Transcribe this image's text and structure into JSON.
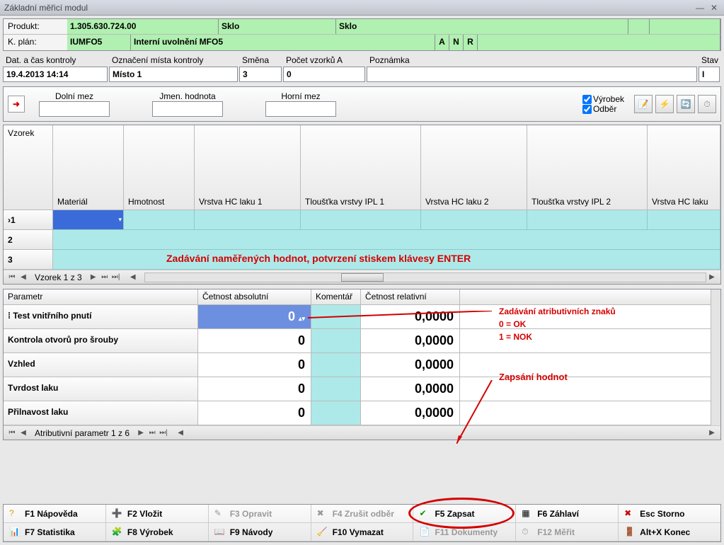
{
  "title": "Základní měřicí modul",
  "prod": {
    "lbl_produkt": "Produkt:",
    "lbl_kplan": "K. plán:",
    "produkt_kod": "1.305.630.724.00",
    "produkt_typ1": "Sklo",
    "produkt_typ2": "Sklo",
    "kplan_kod": "IUMFO5",
    "kplan_nazev": "Interní uvolnění MFO5",
    "a": "A",
    "n": "N",
    "r": "R"
  },
  "hdr": {
    "lbl_dat": "Dat. a čas kontroly",
    "lbl_misto": "Označení místa kontroly",
    "lbl_smena": "Směna",
    "lbl_pocet": "Počet vzorků A",
    "lbl_pozn": "Poznámka",
    "lbl_stav": "Stav",
    "dat": "19.4.2013 14:14",
    "misto": "Místo 1",
    "smena": "3",
    "pocet": "0",
    "pozn": "",
    "stav": "I"
  },
  "limits": {
    "dolni": "Dolní mez",
    "jmen": "Jmen. hodnota",
    "horni": "Horní mez",
    "chk_vyrobek": "Výrobek",
    "chk_odber": "Odběr"
  },
  "grid1": {
    "corner": "Vzorek",
    "cols": [
      "Materiál",
      "Hmotnost",
      "Vrstva HC laku 1",
      "Tloušťka vrstvy IPL 1",
      "Vrstva HC laku 2",
      "Tloušťka vrstvy IPL 2",
      "Vrstva HC laku"
    ],
    "rows": [
      "1",
      "2",
      "3"
    ],
    "nav": "Vzorek 1 z 3",
    "annotation": "Zadávání naměřených hodnot, potvrzení stiskem klávesy ENTER"
  },
  "grid2": {
    "hdr": {
      "param": "Parametr",
      "abs": "Četnost absolutní",
      "kom": "Komentář",
      "rel": "Četnost relativní"
    },
    "rows": [
      {
        "p": "Test vnitřního pnutí",
        "abs": "0",
        "rel": "0,0000",
        "sel": true
      },
      {
        "p": "Kontrola otvorů pro šrouby",
        "abs": "0",
        "rel": "0,0000"
      },
      {
        "p": "Vzhled",
        "abs": "0",
        "rel": "0,0000"
      },
      {
        "p": "Tvrdost laku",
        "abs": "0",
        "rel": "0,0000"
      },
      {
        "p": "Přilnavost laku",
        "abs": "0",
        "rel": "0,0000"
      }
    ],
    "nav": "Atributivní parametr 1 z 6",
    "ann1": "Zadávání atributivních znaků",
    "ann2": "0 = OK",
    "ann3": "1 = NOK",
    "ann4": "Zapsání hodnot"
  },
  "buttons": {
    "f1": "F1 Nápověda",
    "f2": "F2 Vložit",
    "f3": "F3 Opravit",
    "f4": "F4 Zrušit odběr",
    "f5": "F5 Zapsat",
    "f6": "F6 Záhlaví",
    "esc": "Esc Storno",
    "f7": "F7 Statistika",
    "f8": "F8 Výrobek",
    "f9": "F9 Návody",
    "f10": "F10 Vymazat",
    "f11": "F11 Dokumenty",
    "f12": "F12 Měřit",
    "altx": "Alt+X Konec"
  },
  "icons": {
    "q": "?",
    "plus": "➕",
    "pencil": "✎",
    "cross": "✖",
    "check": "✔",
    "grid": "▦",
    "stat": "📊",
    "prod": "🧩",
    "book": "📖",
    "erase": "🧹",
    "doc": "📄",
    "clock": "⏱",
    "exit": "🚪",
    "new": "📝",
    "flash": "⚡",
    "refresh": "🔄",
    "arrow": "➜"
  }
}
